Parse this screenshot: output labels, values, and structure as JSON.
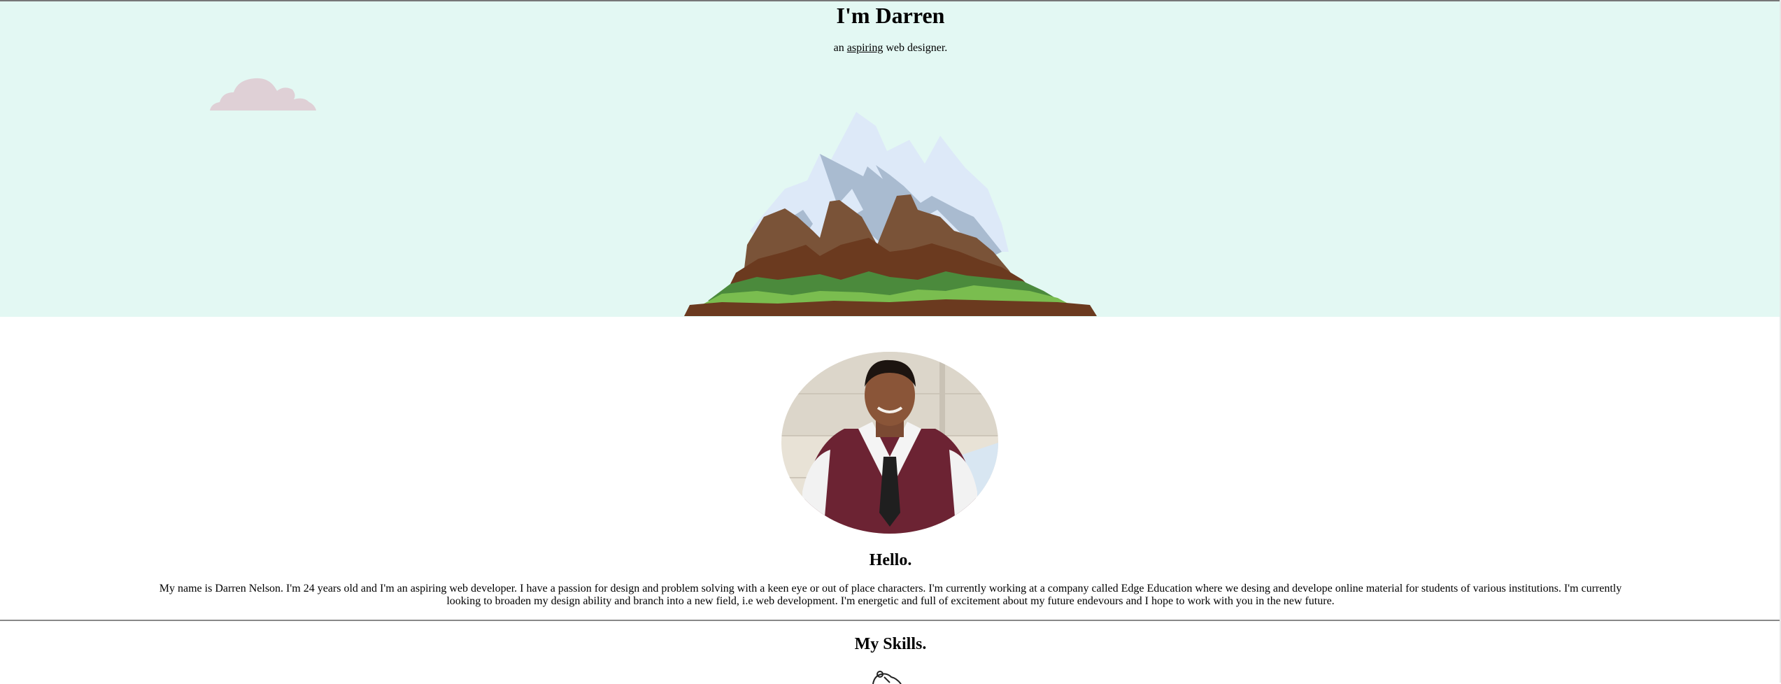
{
  "hero": {
    "title": "I'm Darren",
    "subtitle_prefix": "an",
    "subtitle_link": "aspiring",
    "subtitle_suffix": "web designer.",
    "background_color": "#e3f8f3",
    "cloud_icon": "cloud-icon",
    "mountain_icon": "mountain-illustration"
  },
  "about": {
    "avatar_alt": "Darren Nelson profile photo",
    "heading": "Hello.",
    "bio_line1": "My name is Darren Nelson. I'm 24 years old and I'm an aspiring web developer. I have a passion for design and problem solving with a keen eye or out of place characters. I'm currently working at a company called Edge Education where we desing and develope online material for students of various institutions. I'm currently",
    "bio_line2": "looking to broaden my design ability and branch into a new field, i.e web development. I'm energetic and full of excitement about my future endevours and I hope to work with you in the new future."
  },
  "skills": {
    "heading": "My Skills.",
    "icon": "skill-icon"
  }
}
